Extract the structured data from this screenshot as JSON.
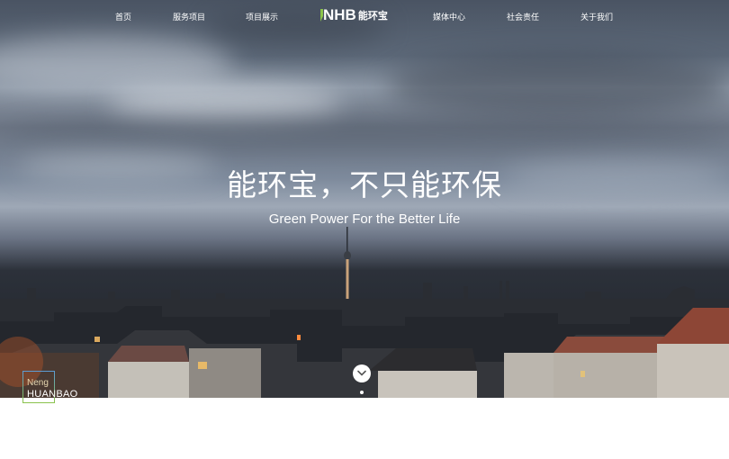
{
  "nav": {
    "items": [
      "首页",
      "服务项目",
      "项目展示",
      "媒体中心",
      "社会责任",
      "关于我们"
    ]
  },
  "logo": {
    "mark": "NHB",
    "name": "能环宝"
  },
  "hero": {
    "headline": "能环宝，不只能环保",
    "subline": "Green Power For the Better Life"
  },
  "brand": {
    "top": "Neng",
    "bottom": "HUANBAO"
  },
  "colors": {
    "accent": "#8bc34a",
    "nav_text": "#ffffff",
    "page_bg": "#ffffff"
  },
  "icons": {
    "scroll": "chevron-down-icon"
  }
}
